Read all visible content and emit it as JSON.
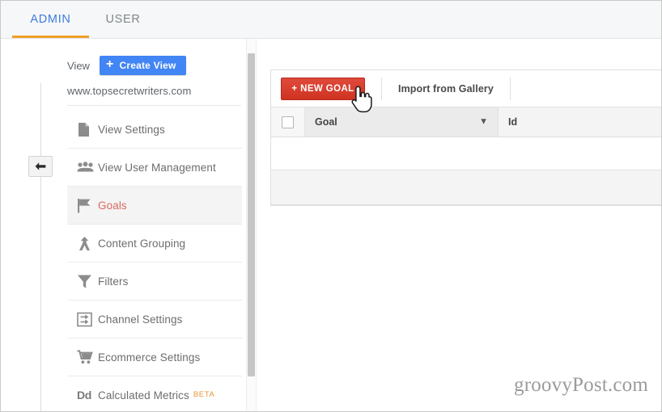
{
  "tabs": [
    {
      "label": "ADMIN",
      "active": true
    },
    {
      "label": "USER",
      "active": false
    }
  ],
  "sidebar": {
    "view_label": "View",
    "create_view_button": "Create View",
    "create_view_plus": "+",
    "account_name": "www.topsecretwriters.com",
    "collapse_icon": "arrow-left-icon",
    "items": [
      {
        "label": "View Settings",
        "icon": "document-icon",
        "active": false
      },
      {
        "label": "View User Management",
        "icon": "people-icon",
        "active": false
      },
      {
        "label": "Goals",
        "icon": "flag-icon",
        "active": true
      },
      {
        "label": "Content Grouping",
        "icon": "merge-arrow-icon",
        "active": false
      },
      {
        "label": "Filters",
        "icon": "funnel-icon",
        "active": false
      },
      {
        "label": "Channel Settings",
        "icon": "channel-arrows-icon",
        "active": false
      },
      {
        "label": "Ecommerce Settings",
        "icon": "shopping-cart-icon",
        "active": false
      },
      {
        "label": "Calculated Metrics",
        "icon": "dd-glyph-icon",
        "badge": "BETA",
        "active": false
      }
    ]
  },
  "main": {
    "toolbar": {
      "new_goal_button": "+ NEW GOAL",
      "import_link": "Import from Gallery"
    },
    "table": {
      "columns": [
        {
          "key": "check",
          "label": "",
          "icon": "checkbox-icon"
        },
        {
          "key": "goal",
          "label": "Goal",
          "sorted": true,
          "sort_icon": "arrow-down-icon"
        },
        {
          "key": "id",
          "label": "Id",
          "sorted": false
        }
      ],
      "rows": []
    }
  },
  "watermark": "groovyPost.com",
  "colors": {
    "tab_active": "#3c7ddd",
    "tab_underline": "#f0a028",
    "create_view_blue": "#4285f4",
    "new_goal_red": "#cf3322",
    "active_nav_text": "#d9685f",
    "beta_orange": "#e8963a"
  }
}
